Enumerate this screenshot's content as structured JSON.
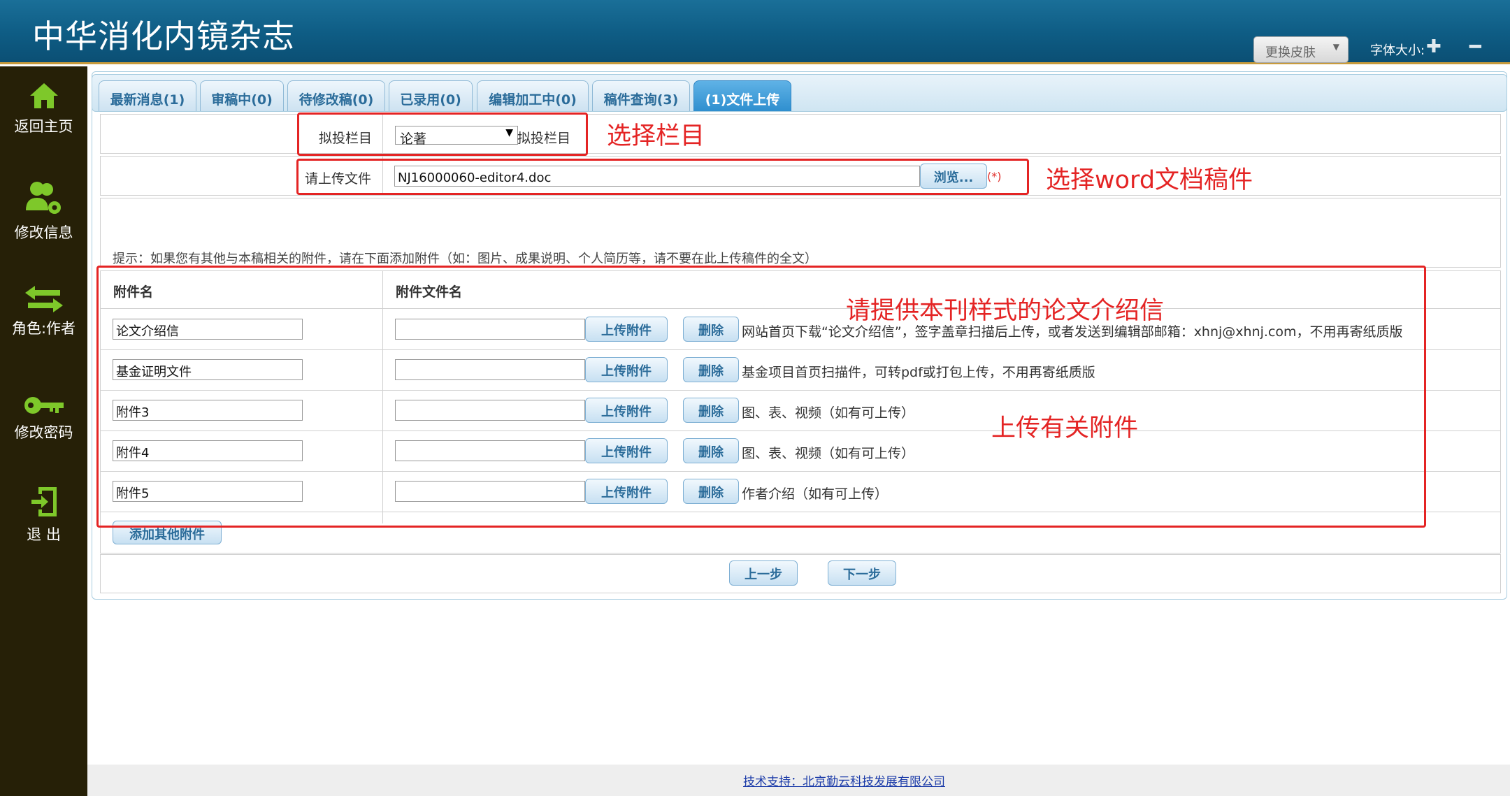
{
  "header": {
    "title": "中华消化内镜杂志",
    "skin_label": "更换皮肤",
    "font_size_label": "字体大小:",
    "font_plus": "✚",
    "font_minus": "━"
  },
  "sidebar": {
    "items": [
      {
        "label": "返回主页",
        "icon": "home-icon"
      },
      {
        "label": "修改信息",
        "icon": "user-settings-icon"
      },
      {
        "label": "角色:作者",
        "icon": "swap-arrows-icon"
      },
      {
        "label": "修改密码",
        "icon": "key-icon"
      },
      {
        "label": "退 出",
        "icon": "exit-icon"
      }
    ]
  },
  "tabs": [
    {
      "label": "最新消息(1)"
    },
    {
      "label": "审稿中(0)"
    },
    {
      "label": "待修改稿(0)"
    },
    {
      "label": "已录用(0)"
    },
    {
      "label": "编辑加工中(0)"
    },
    {
      "label": "稿件查询(3)"
    },
    {
      "label": "(1)文件上传",
      "active": true
    }
  ],
  "form": {
    "column_label": "拟投栏目",
    "column_value": "论著",
    "column_suffix": "拟投栏目",
    "upload_label": "请上传文件",
    "upload_value": "NJ16000060-editor4.doc",
    "browse_label": "浏览...",
    "required_mark": "(*)",
    "hint": "提示：如果您有其他与本稿相关的附件，请在下面添加附件（如：图片、成果说明、个人简历等，请不要在此上传稿件的全文）",
    "attach_header_name": "附件名",
    "attach_header_file": "附件文件名",
    "upload_attach_label": "上传附件",
    "delete_label": "删除",
    "attachments": [
      {
        "name": "论文介绍信",
        "file": "",
        "note": "网站首页下载“论文介绍信”，签字盖章扫描后上传，或者发送到编辑部邮箱：xhnj@xhnj.com，不用再寄纸质版"
      },
      {
        "name": "基金证明文件",
        "file": "",
        "note": "基金项目首页扫描件，可转pdf或打包上传，不用再寄纸质版"
      },
      {
        "name": "附件3",
        "file": "",
        "note": "图、表、视频（如有可上传）"
      },
      {
        "name": "附件4",
        "file": "",
        "note": "图、表、视频（如有可上传）"
      },
      {
        "name": "附件5",
        "file": "",
        "note": "作者介绍（如有可上传）"
      }
    ],
    "add_other_label": "添加其他附件",
    "prev_label": "上一步",
    "next_label": "下一步"
  },
  "annotations": {
    "select_column": "选择栏目",
    "select_word": "选择word文档稿件",
    "intro_letter": "请提供本刊样式的论文介绍信",
    "upload_attachments": "上传有关附件"
  },
  "footer": {
    "support": "技术支持：北京勤云科技发展有限公司"
  },
  "colors": {
    "header": "#0e5c84",
    "sidebar": "#262007",
    "icon_green": "#7ec82a",
    "annotation": "#e42424",
    "active_tab": "#2f8fcf"
  }
}
